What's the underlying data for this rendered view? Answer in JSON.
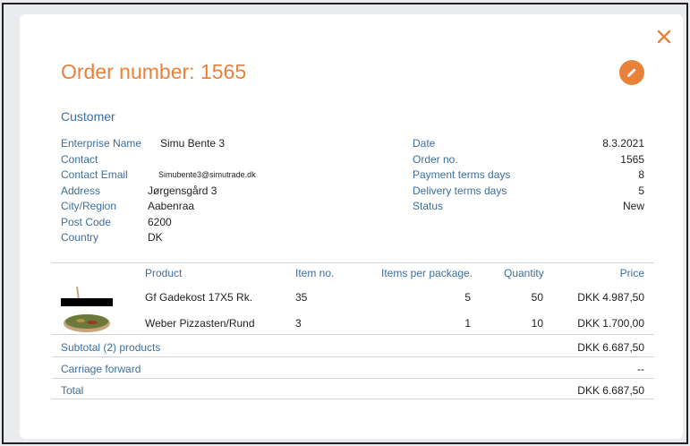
{
  "header": {
    "title": "Order number: 1565",
    "close_icon": "close-icon",
    "edit_icon": "pencil-icon",
    "accent_color": "#e8823a"
  },
  "customer": {
    "section_title": "Customer",
    "fields": [
      {
        "label": "Enterprise Name",
        "value": "Simu Bente 3"
      },
      {
        "label": "Contact",
        "value": ""
      },
      {
        "label": "Contact Email",
        "value": "Simubente3@simutrade.dk"
      },
      {
        "label": "Address",
        "value": "Jørgensgård 3"
      },
      {
        "label": "City/Region",
        "value": "Aabenraa"
      },
      {
        "label": "Post Code",
        "value": "6200"
      },
      {
        "label": "Country",
        "value": "DK"
      }
    ],
    "order_fields": [
      {
        "label": "Date",
        "value": "8.3.2021"
      },
      {
        "label": "Order no.",
        "value": "1565"
      },
      {
        "label": "Payment terms days",
        "value": "8"
      },
      {
        "label": "Delivery terms days",
        "value": "5"
      },
      {
        "label": "Status",
        "value": "New"
      }
    ]
  },
  "products": {
    "columns": {
      "product": "Product",
      "item_no": "Item no.",
      "per_package": "Items per package.",
      "quantity": "Quantity",
      "price": "Price"
    },
    "rows": [
      {
        "product": "Gf Gadekost 17X5 Rk.",
        "item_no": "35",
        "per_package": "5",
        "quantity": "50",
        "price": "DKK 4.987,50"
      },
      {
        "product": "Weber Pizzasten/Rund",
        "item_no": "3",
        "per_package": "1",
        "quantity": "10",
        "price": "DKK 1.700,00"
      }
    ]
  },
  "summary": {
    "subtotal_label": "Subtotal (2) products",
    "subtotal_value": "DKK 6.687,50",
    "carriage_label": "Carriage forward",
    "carriage_value": "--",
    "total_label": "Total",
    "total_value": "DKK 6.687,50"
  }
}
